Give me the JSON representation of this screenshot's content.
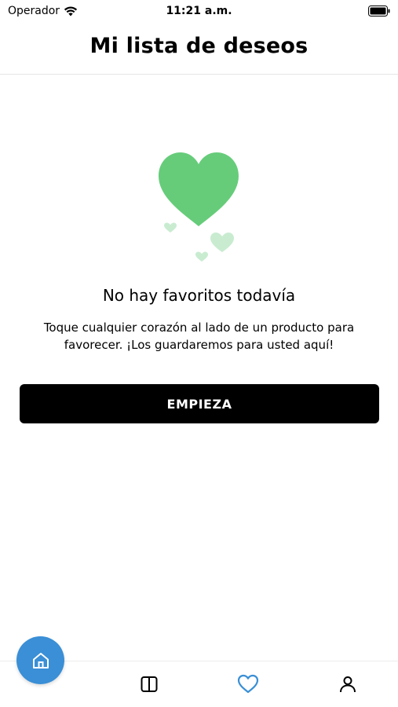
{
  "status_bar": {
    "carrier": "Operador",
    "time": "11:21 a.m."
  },
  "header": {
    "title": "Mi lista de deseos"
  },
  "empty_state": {
    "title": "No hay favoritos todavía",
    "description": "Toque cualquier corazón al lado de un producto para favorecer. ¡Los guardaremos para usted aquí!",
    "illustration_color": "#66cc7a"
  },
  "primary_action": {
    "label": "EMPIEZA"
  },
  "tab_bar": {
    "tabs": [
      {
        "icon": "home-icon",
        "active": false
      },
      {
        "icon": "catalog-icon",
        "active": false
      },
      {
        "icon": "heart-icon",
        "active": true
      },
      {
        "icon": "user-icon",
        "active": false
      }
    ],
    "accent_color": "#3a8fd6"
  }
}
